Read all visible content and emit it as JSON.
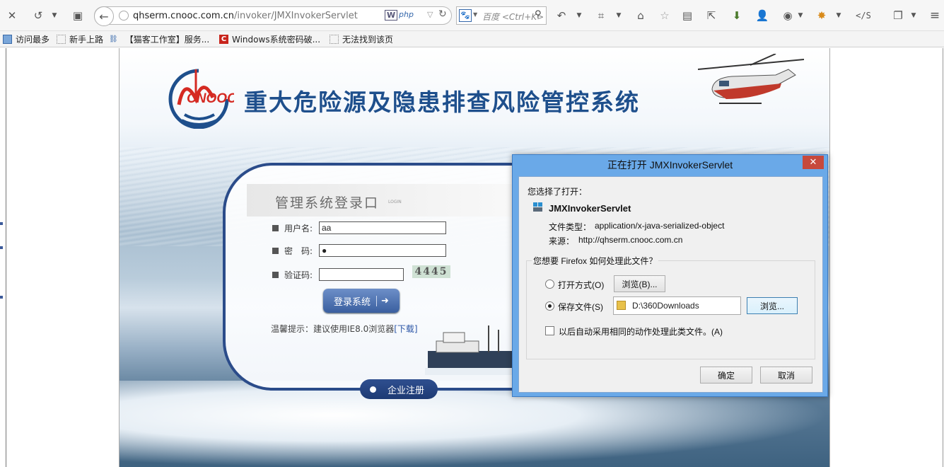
{
  "browser": {
    "url_host": "qhserm.cnooc.com.cn",
    "url_path": "/invoker/JMXInvokerServlet",
    "search_placeholder": "百度 <Ctrl+K>",
    "dev_tool_label": "</S"
  },
  "bookmarks": [
    {
      "label": "访问最多"
    },
    {
      "label": "新手上路"
    },
    {
      "label": "【猫客工作室】服务..."
    },
    {
      "label": "Windows系统密码破..."
    },
    {
      "label": "无法找到该页"
    }
  ],
  "site": {
    "title": "重大危险源及隐患排查风险管控系统",
    "logo_text": "CNOOC",
    "panel_title": "管理系统登录口",
    "panel_subtitle": "LOGIN",
    "username_label": "用户名:",
    "username_value": "aa",
    "password_label": "密　码:",
    "password_value": "●",
    "captcha_label": "验证码:",
    "captcha_value": "",
    "captcha_image_text": "4445",
    "login_button": "登录系统",
    "tip_prefix": "温馨提示：建议使用IE8.0浏览器",
    "tip_link": "[下载]",
    "register_button": "企业注册"
  },
  "dialog": {
    "title": "正在打开 JMXInvokerServlet",
    "close_label": "✕",
    "chosen_label": "您选择了打开：",
    "file_name": "JMXInvokerServlet",
    "file_type_label": "文件类型：",
    "file_type_value": "application/x-java-serialized-object",
    "source_label": "来源：",
    "source_value": "http://qhserm.cnooc.com.cn",
    "question": "您想要 Firefox 如何处理此文件？",
    "open_with_label": "打开方式(O)",
    "browse_button_1": "浏览(B)...",
    "save_file_label": "保存文件(S)",
    "save_path": "D:\\360Downloads",
    "browse_button_2": "浏览...",
    "auto_label": "以后自动采用相同的动作处理此类文件。(A)",
    "ok_button": "确定",
    "cancel_button": "取消",
    "selected_option": "save_file",
    "auto_checked": false
  }
}
